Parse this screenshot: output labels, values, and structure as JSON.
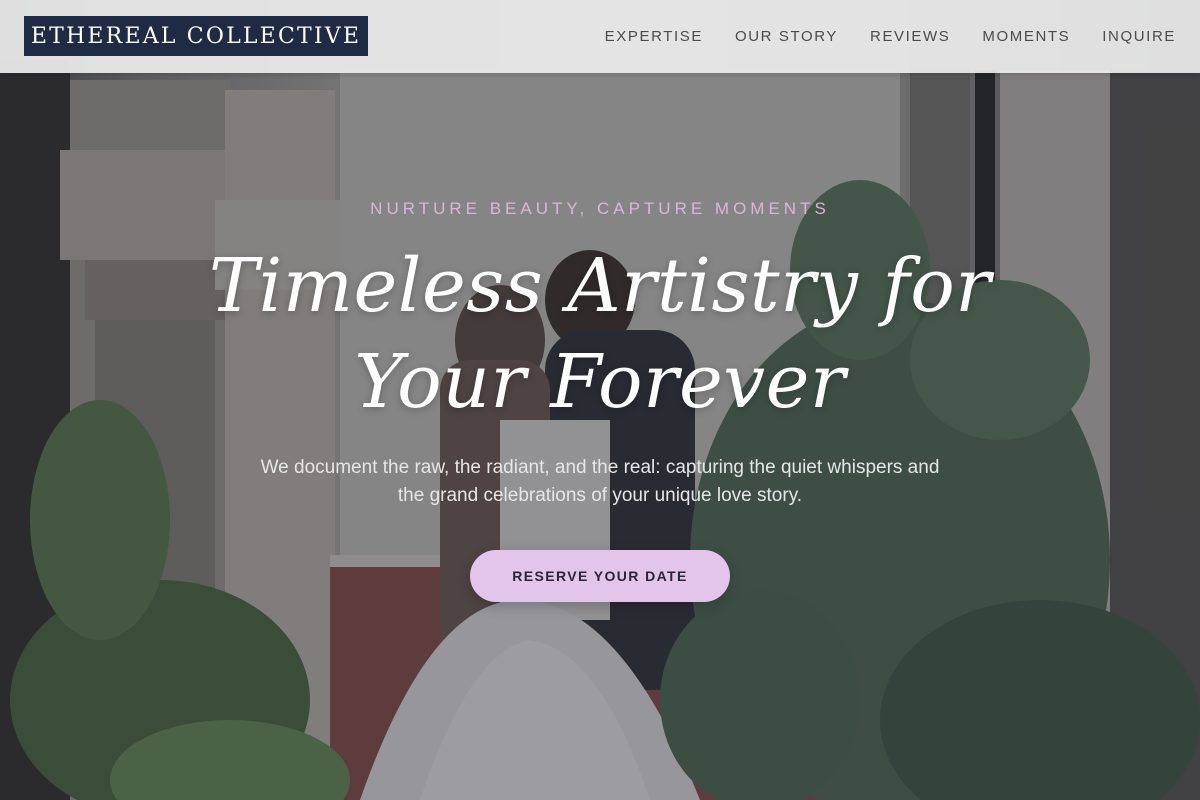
{
  "brand": {
    "name": "ETHEREAL COLLECTIVE"
  },
  "nav": {
    "items": [
      {
        "label": "EXPERTISE"
      },
      {
        "label": "OUR STORY"
      },
      {
        "label": "REVIEWS"
      },
      {
        "label": "MOMENTS"
      },
      {
        "label": "INQUIRE"
      }
    ]
  },
  "hero": {
    "tagline": "NURTURE BEAUTY, CAPTURE MOMENTS",
    "headline_line1": "Timeless Artistry for",
    "headline_line2": "Your Forever",
    "subtext": "We document the raw, the radiant, and the real: capturing the quiet whispers and the grand celebrations of your unique love story.",
    "cta_label": "RESERVE YOUR DATE"
  },
  "colors": {
    "logo_bg": "#1f2a44",
    "tagline": "#d9b6d9",
    "cta_bg": "#e3c4ea",
    "cta_text": "#2a2438",
    "header_bg": "#ececec"
  }
}
